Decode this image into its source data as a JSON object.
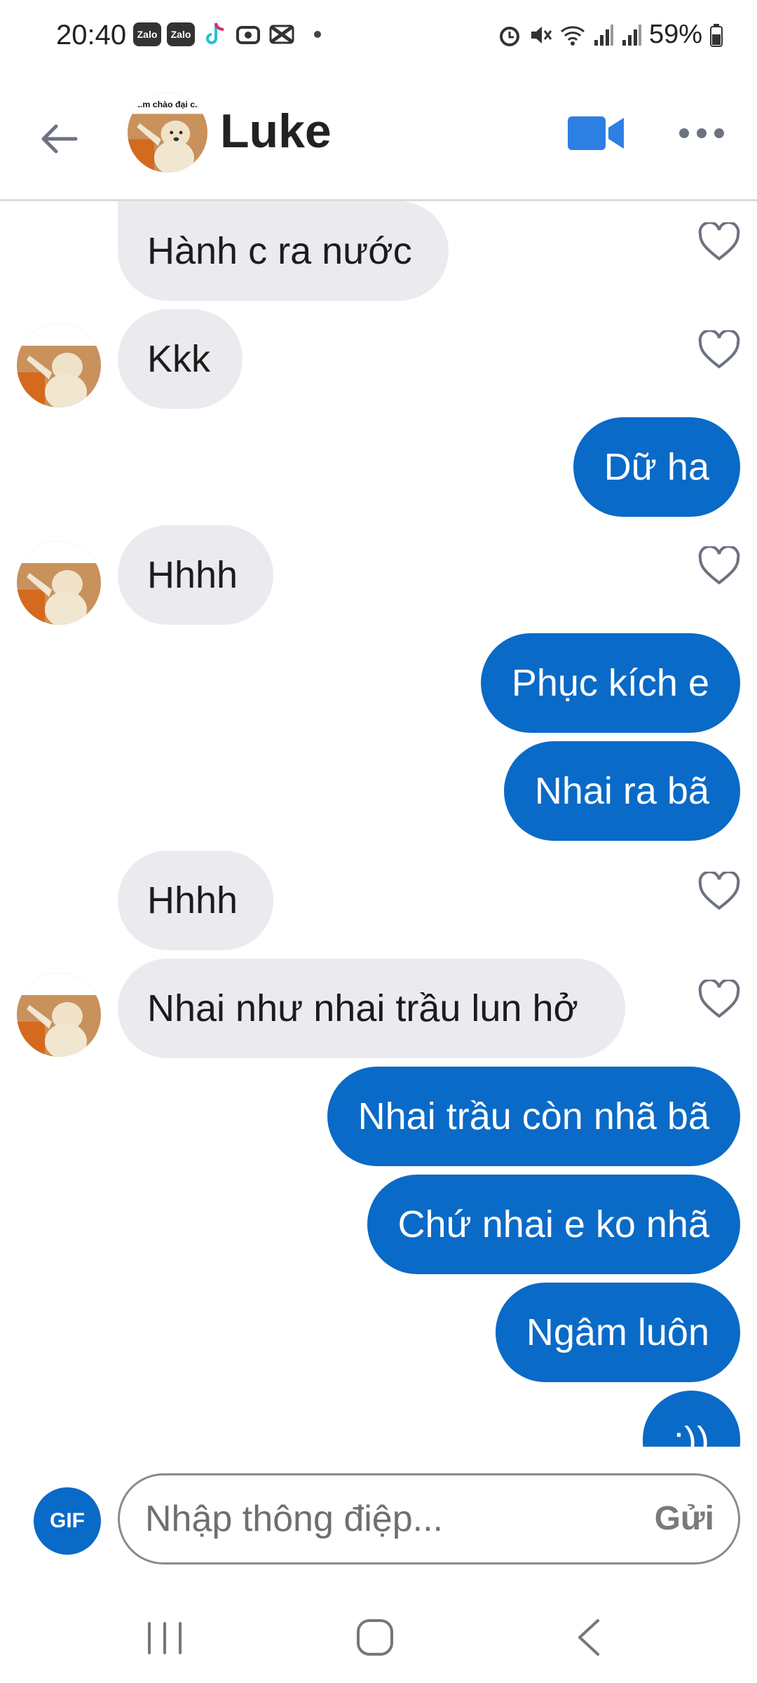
{
  "status_bar": {
    "time": "20:40",
    "left_icons": [
      "zalo-icon",
      "zalo-icon",
      "tiktok-icon",
      "capcut-icon",
      "capcut-icon"
    ],
    "zalo_label": "Zalo",
    "battery": "59%",
    "right_icons": [
      "alarm-icon",
      "mute-icon",
      "wifi-icon",
      "signal-icon",
      "signal-icon",
      "battery-icon"
    ]
  },
  "header": {
    "contact_name": "Luke",
    "avatar_caption": "...m chào đại c..",
    "icons": {
      "back": "back-arrow-icon",
      "video": "video-call-icon",
      "more": "more-icon"
    },
    "accent_color": "#2d7fe3"
  },
  "messages": [
    {
      "direction": "in",
      "text": "Hành c ra nước",
      "show_avatar": false
    },
    {
      "direction": "in",
      "text": "Kkk",
      "show_avatar": true
    },
    {
      "direction": "out",
      "text": "Dữ ha"
    },
    {
      "direction": "in",
      "text": "Hhhh",
      "show_avatar": true
    },
    {
      "direction": "out",
      "text": "Phục kích e"
    },
    {
      "direction": "out",
      "text": "Nhai ra bã"
    },
    {
      "direction": "in",
      "text": "Hhhh",
      "show_avatar": false
    },
    {
      "direction": "in",
      "text": "Nhai như nhai trầu lun hở",
      "show_avatar": true
    },
    {
      "direction": "out",
      "text": "Nhai trầu còn nhã bã"
    },
    {
      "direction": "out",
      "text": "Chứ nhai e ko nhã"
    },
    {
      "direction": "out",
      "text": "Ngâm luôn"
    },
    {
      "direction": "out",
      "text": ":))"
    }
  ],
  "colors": {
    "incoming_bubble": "#ebebef",
    "outgoing_bubble": "#0a6ac7",
    "outgoing_text": "#ffffff"
  },
  "composer": {
    "gif_label": "GIF",
    "placeholder": "Nhập thông điệp...",
    "send_label": "Gửi"
  },
  "navbar": {
    "icons": [
      "recent-apps-icon",
      "home-icon",
      "back-icon"
    ]
  }
}
